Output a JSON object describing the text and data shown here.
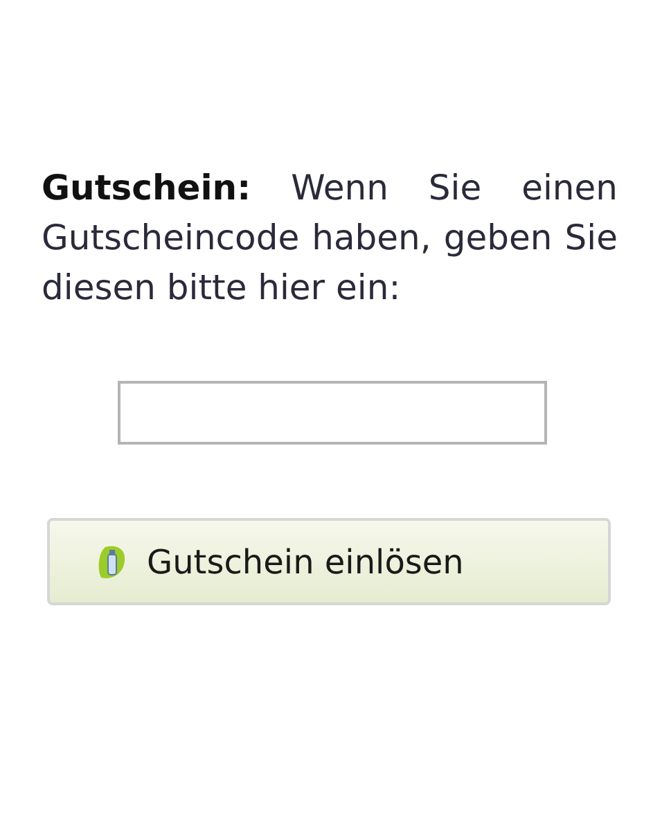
{
  "voucher": {
    "text": "**Gutschein:** Wenn Sie einen Gutscheincode haben, geben Sie diesen bitte hier ein:",
    "redeem_button": {
      "label": "Gutschein einlösen"
    }
  }
}
